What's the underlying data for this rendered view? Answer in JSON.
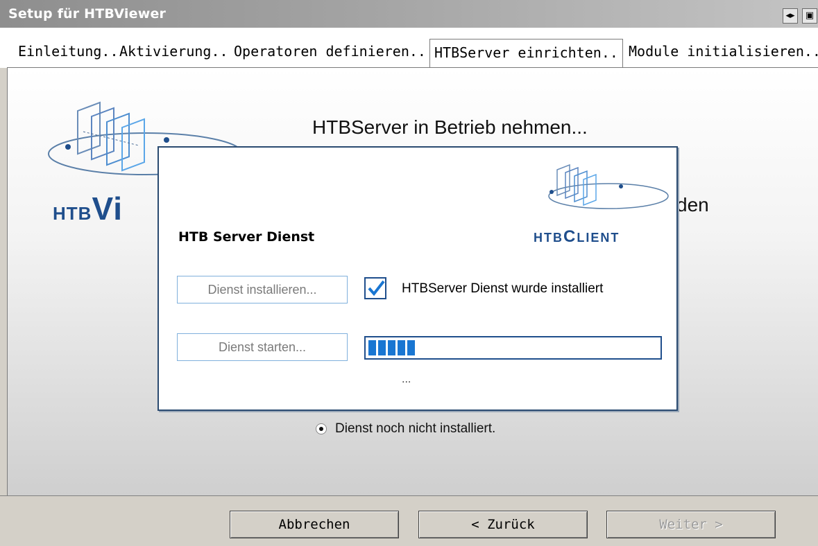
{
  "window": {
    "title": "Setup für HTBViewer",
    "controls": [
      {
        "name": "restore-icon",
        "glyph": "◂▸"
      },
      {
        "name": "window-icon",
        "glyph": "▣"
      }
    ]
  },
  "tabs": [
    {
      "label": "Einleitung..",
      "active": false
    },
    {
      "label": "Aktivierung..",
      "active": false
    },
    {
      "label": "Operatoren definieren..",
      "active": false
    },
    {
      "label": "HTBServer einrichten..",
      "active": true
    },
    {
      "label": "Module initialisieren..",
      "active": false
    }
  ],
  "main": {
    "brand_prefix": "HTB",
    "brand_big": "Vi",
    "heading": "HTBServer in Betrieb nehmen...",
    "partial_text": "den",
    "radio_label": "Dienst noch nicht installiert."
  },
  "dialog": {
    "title": "HTB Server Dienst",
    "brand_prefix": "HTB",
    "brand_big": "C",
    "brand_rest": "LIENT",
    "install_button": "Dienst installieren...",
    "start_button": "Dienst starten...",
    "installed_checkbox_checked": true,
    "installed_label": "HTBServer Dienst wurde installiert",
    "progress_percent": 16,
    "status_text": "..."
  },
  "footer": {
    "cancel": "Abbrechen",
    "back": "< Zurück",
    "next": "Weiter >",
    "next_enabled": false
  },
  "colors": {
    "brand_blue": "#1f4e8c",
    "progress_blue": "#1976d2",
    "dialog_border": "#2a4a70"
  }
}
